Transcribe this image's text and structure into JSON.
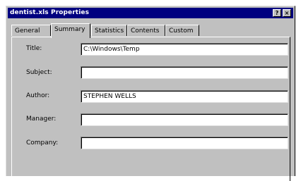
{
  "window": {
    "title": "dentist.xls Properties",
    "help_label": "?",
    "close_label": "×"
  },
  "tabs": [
    {
      "label": "General",
      "active": false
    },
    {
      "label": "Summary",
      "active": true
    },
    {
      "label": "Statistics",
      "active": false
    },
    {
      "label": "Contents",
      "active": false
    },
    {
      "label": "Custom",
      "active": false
    }
  ],
  "fields": {
    "title": {
      "label": "Title:",
      "value": "C:\\Windows\\Temp"
    },
    "subject": {
      "label": "Subject:",
      "value": ""
    },
    "author": {
      "label": "Author:",
      "value": "STEPHEN WELLS"
    },
    "manager": {
      "label": "Manager:",
      "value": ""
    },
    "company": {
      "label": "Company:",
      "value": ""
    }
  }
}
